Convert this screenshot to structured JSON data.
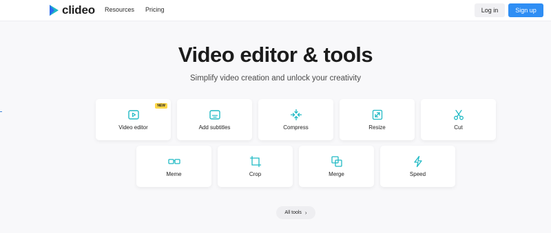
{
  "header": {
    "logo_text": "clideo",
    "nav": [
      "Resources",
      "Pricing"
    ],
    "login_label": "Log in",
    "signup_label": "Sign up"
  },
  "hero": {
    "title": "Video editor & tools",
    "subtitle": "Simplify video creation and unlock your creativity"
  },
  "tools": [
    {
      "label": "Video editor",
      "icon": "play-square-icon",
      "badge": "NEW"
    },
    {
      "label": "Add subtitles",
      "icon": "subtitles-icon"
    },
    {
      "label": "Compress",
      "icon": "compress-icon"
    },
    {
      "label": "Resize",
      "icon": "resize-icon"
    },
    {
      "label": "Cut",
      "icon": "scissors-icon"
    },
    {
      "label": "Meme",
      "icon": "meme-icon"
    },
    {
      "label": "Crop",
      "icon": "crop-icon"
    },
    {
      "label": "Merge",
      "icon": "merge-icon"
    },
    {
      "label": "Speed",
      "icon": "lightning-icon"
    }
  ],
  "all_tools_label": "All tools",
  "colors": {
    "accent": "#1fb9c4",
    "primary_button": "#2f8ef4",
    "badge": "#ffd84a",
    "background": "#f8f8fa"
  }
}
